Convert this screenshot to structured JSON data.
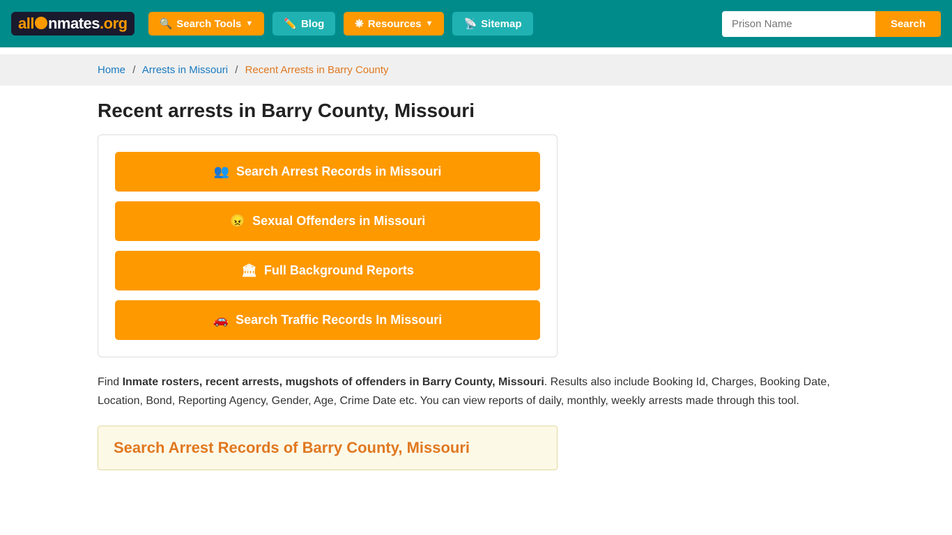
{
  "header": {
    "logo": {
      "part1": "all",
      "part2": "Inmates",
      "part3": ".org"
    },
    "nav": [
      {
        "id": "search-tools",
        "label": "Search Tools",
        "has_dropdown": true
      },
      {
        "id": "blog",
        "label": "Blog",
        "has_dropdown": false
      },
      {
        "id": "resources",
        "label": "Resources",
        "has_dropdown": true
      },
      {
        "id": "sitemap",
        "label": "Sitemap",
        "has_dropdown": false
      }
    ],
    "search_placeholder": "Prison Name",
    "search_button_label": "Search"
  },
  "breadcrumb": {
    "home": "Home",
    "arrests": "Arrests in Missouri",
    "current": "Recent Arrests in Barry County"
  },
  "page": {
    "title": "Recent arrests in Barry County, Missouri",
    "action_buttons": [
      {
        "id": "search-arrest-records",
        "icon": "👥",
        "label": "Search Arrest Records in Missouri"
      },
      {
        "id": "sexual-offenders",
        "icon": "😠",
        "label": "Sexual Offenders in Missouri"
      },
      {
        "id": "background-reports",
        "icon": "🏛",
        "label": "Full Background Reports"
      },
      {
        "id": "traffic-records",
        "icon": "🚗",
        "label": "Search Traffic Records In Missouri"
      }
    ],
    "description_prefix": "Find ",
    "description_bold": "Inmate rosters, recent arrests, mugshots of offenders in Barry County, Missouri",
    "description_suffix": ". Results also include Booking Id, Charges, Booking Date, Location, Bond, Reporting Agency, Gender, Age, Crime Date etc. You can view reports of daily, monthly, weekly arrests made through this tool.",
    "search_section_title": "Search Arrest Records of Barry County, Missouri"
  }
}
